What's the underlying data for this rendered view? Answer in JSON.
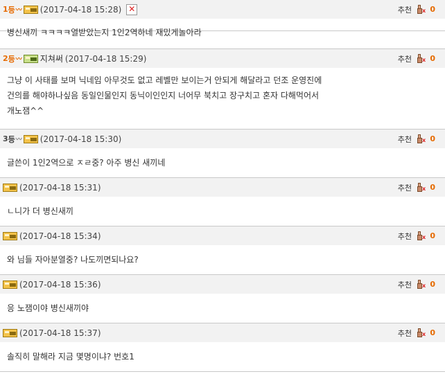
{
  "recommend_label": "추천",
  "comments": [
    {
      "rank": "1",
      "time": "(2017-04-18 15:28)",
      "count": "0",
      "body": [
        "병신새끼 ㅋㅋㅋㅋ열받았는지 1인2역하네 재밌게놀아라"
      ]
    },
    {
      "rank": "2",
      "nick": "지쳐써",
      "time": "(2017-04-18 15:29)",
      "count": "0",
      "body": [
        "그냥 이 사태를 보며 닉네임 아무것도 없고 레벨만 보이는거 안되게 해달라고 던조 운영진에",
        "건의를 해야하나싶음 동일인물인지 동닉이인인지 너어무 북치고 장구치고 혼자 다해먹어서",
        "개노잼^^"
      ]
    },
    {
      "rank": "3",
      "time": "(2017-04-18 15:30)",
      "count": "0",
      "body": [
        "글쓴이 1인2역으로 ㅈㄹ중? 아주 병신 새끼네"
      ]
    },
    {
      "time": "(2017-04-18 15:31)",
      "count": "0",
      "body": [
        "ㄴ니가 더 병신새끼"
      ]
    },
    {
      "time": "(2017-04-18 15:34)",
      "count": "0",
      "body": [
        "와 님들 자아분열중? 나도끼면되나요?"
      ]
    },
    {
      "time": "(2017-04-18 15:36)",
      "count": "0",
      "body": [
        "응 노잼이야 병신새끼야"
      ]
    },
    {
      "time": "(2017-04-18 15:37)",
      "count": "0",
      "body": [
        "솔직히 말해라 지금 몇명이냐? 번호1"
      ]
    }
  ],
  "rank_suffix": "등",
  "colors": {
    "accent": "#e66a00",
    "header_bg": "#f2f2f2",
    "border": "#c8c8c8"
  },
  "icons": {
    "level": "level-badge-icon",
    "delete": "delete-icon",
    "recommend": "thumbs-up-icon"
  }
}
